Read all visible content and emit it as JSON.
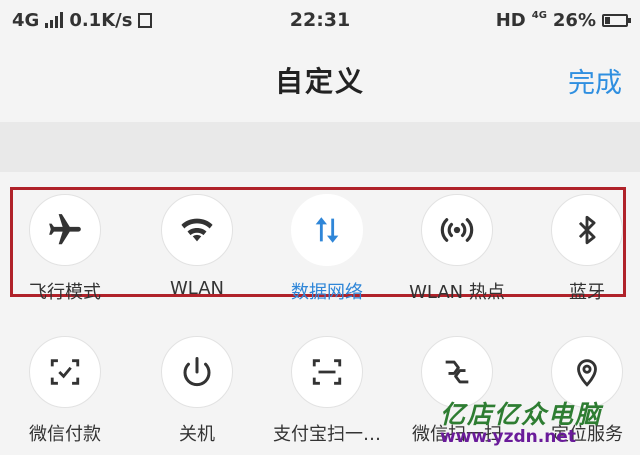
{
  "status": {
    "network": "4G",
    "speed": "0.1K/s",
    "time": "22:31",
    "hd": "HD",
    "net_small": "4G",
    "battery": "26%",
    "battery_level": 0.26
  },
  "header": {
    "title": "自定义",
    "done": "完成"
  },
  "toggles": [
    {
      "label": "飞行模式",
      "icon": "airplane-icon",
      "active": false
    },
    {
      "label": "WLAN",
      "icon": "wifi-icon",
      "active": false
    },
    {
      "label": "数据网络",
      "icon": "mobile-data-icon",
      "active": true
    },
    {
      "label": "WLAN 热点",
      "icon": "hotspot-icon",
      "active": false
    },
    {
      "label": "蓝牙",
      "icon": "bluetooth-icon",
      "active": false
    }
  ],
  "shortcuts": [
    {
      "label": "微信付款",
      "icon": "wechat-pay-icon"
    },
    {
      "label": "关机",
      "icon": "power-icon"
    },
    {
      "label": "支付宝扫一…",
      "icon": "alipay-scan-icon"
    },
    {
      "label": "微信扫一扫",
      "icon": "wechat-scan-icon"
    },
    {
      "label": "定位服务",
      "icon": "location-icon"
    }
  ],
  "colors": {
    "accent": "#2f86d8",
    "highlight_box": "#b0222a"
  },
  "watermark": {
    "brand": "亿店亿众电脑",
    "url": "www.yzdn.net"
  }
}
